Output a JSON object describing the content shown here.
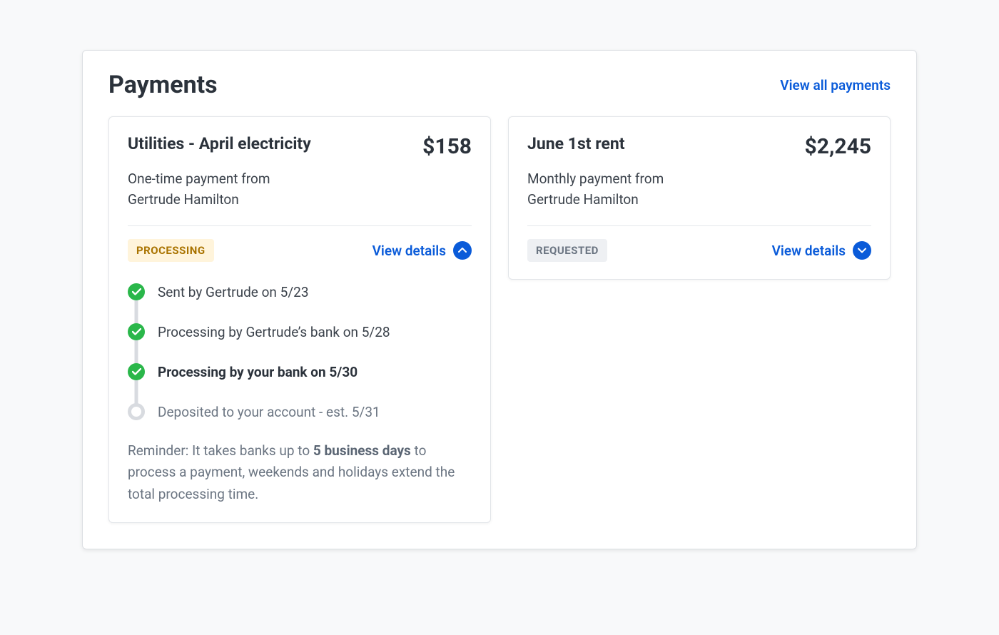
{
  "header": {
    "title": "Payments",
    "view_all_label": "View all payments"
  },
  "cards": [
    {
      "title": "Utilities - April electricity",
      "amount": "$158",
      "subtitle_line1": "One-time payment from",
      "subtitle_line2": "Gertrude Hamilton",
      "status": {
        "label": "PROCESSING",
        "variant": "processing"
      },
      "details_label": "View details",
      "expanded": true,
      "timeline": [
        {
          "text": "Sent by Gertrude on 5/23",
          "state": "done"
        },
        {
          "text": "Processing by Gertrude’s bank on 5/28",
          "state": "done"
        },
        {
          "text": "Processing by your bank on 5/30",
          "state": "current"
        },
        {
          "text": "Deposited to your account - est. 5/31",
          "state": "pending"
        }
      ],
      "reminder": {
        "prefix": "Reminder: It takes banks up to ",
        "bold": "5 business days",
        "suffix": " to process a payment, weekends and holidays extend the total processing time."
      }
    },
    {
      "title": "June 1st rent",
      "amount": "$2,245",
      "subtitle_line1": "Monthly payment from",
      "subtitle_line2": "Gertrude Hamilton",
      "status": {
        "label": "REQUESTED",
        "variant": "requested"
      },
      "details_label": "View details",
      "expanded": false
    }
  ]
}
